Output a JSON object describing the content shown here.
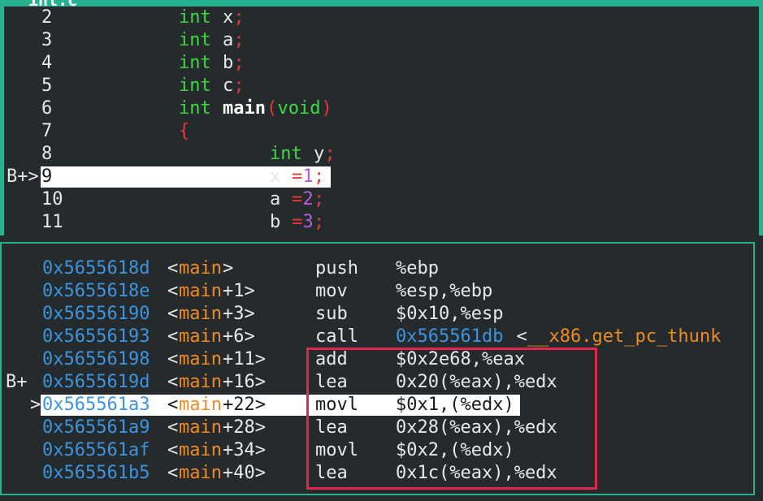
{
  "source": {
    "title": "int.c",
    "lines": [
      {
        "no": "2",
        "marker": "",
        "tokens": [
          {
            "t": "int ",
            "c": "type"
          },
          {
            "t": "x",
            "c": "ident"
          },
          {
            "t": ";",
            "c": "punct"
          }
        ],
        "indent": 1
      },
      {
        "no": "3",
        "marker": "",
        "tokens": [
          {
            "t": "int ",
            "c": "type"
          },
          {
            "t": "a",
            "c": "ident"
          },
          {
            "t": ";",
            "c": "punct"
          }
        ],
        "indent": 1
      },
      {
        "no": "4",
        "marker": "",
        "tokens": [
          {
            "t": "int ",
            "c": "type"
          },
          {
            "t": "b",
            "c": "ident"
          },
          {
            "t": ";",
            "c": "punct"
          }
        ],
        "indent": 1
      },
      {
        "no": "5",
        "marker": "",
        "tokens": [
          {
            "t": "int ",
            "c": "type"
          },
          {
            "t": "c",
            "c": "ident"
          },
          {
            "t": ";",
            "c": "punct"
          }
        ],
        "indent": 1
      },
      {
        "no": "6",
        "marker": "",
        "tokens": [
          {
            "t": "int ",
            "c": "type"
          },
          {
            "t": "main",
            "c": "fn"
          },
          {
            "t": "(",
            "c": "punct"
          },
          {
            "t": "void",
            "c": "type"
          },
          {
            "t": ")",
            "c": "punct"
          }
        ],
        "indent": 1
      },
      {
        "no": "7",
        "marker": "",
        "tokens": [
          {
            "t": "{",
            "c": "punct"
          }
        ],
        "indent": 1
      },
      {
        "no": "8",
        "marker": "",
        "tokens": [
          {
            "t": "int ",
            "c": "type"
          },
          {
            "t": "y",
            "c": "ident"
          },
          {
            "t": ";",
            "c": "punct"
          }
        ],
        "indent": 2
      },
      {
        "no": "9",
        "marker": "B+>",
        "highlight": true,
        "tokens": [
          {
            "t": "x ",
            "c": "ident"
          },
          {
            "t": "=",
            "c": "punct"
          },
          {
            "t": "1",
            "c": "num"
          },
          {
            "t": ";",
            "c": "punct"
          }
        ],
        "indent": 2
      },
      {
        "no": "10",
        "marker": "",
        "tokens": [
          {
            "t": "a ",
            "c": "ident"
          },
          {
            "t": "=",
            "c": "punct"
          },
          {
            "t": "2",
            "c": "num"
          },
          {
            "t": ";",
            "c": "punct"
          }
        ],
        "indent": 2
      },
      {
        "no": "11",
        "marker": "",
        "tokens": [
          {
            "t": "b ",
            "c": "ident"
          },
          {
            "t": "=",
            "c": "punct"
          },
          {
            "t": "3",
            "c": "num"
          },
          {
            "t": ";",
            "c": "punct"
          }
        ],
        "indent": 2
      }
    ]
  },
  "asm": {
    "lines": [
      {
        "marker": "",
        "addr": "0x5655618d",
        "sym": "main",
        "off": "",
        "op": "push",
        "args": "%ebp"
      },
      {
        "marker": "",
        "addr": "0x5655618e",
        "sym": "main",
        "off": "+1",
        "op": "mov",
        "args": "%esp,%ebp"
      },
      {
        "marker": "",
        "addr": "0x56556190",
        "sym": "main",
        "off": "+3",
        "op": "sub",
        "args": "$0x10,%esp"
      },
      {
        "marker": "",
        "addr": "0x56556193",
        "sym": "main",
        "off": "+6",
        "op": "call",
        "args": "",
        "target_addr": "0x565561db",
        "target_sym": "__x86.get_pc_thunk"
      },
      {
        "marker": "",
        "addr": "0x56556198",
        "sym": "main",
        "off": "+11",
        "op": "add",
        "args": "$0x2e68,%eax"
      },
      {
        "marker": "B+",
        "addr": "0x5655619d",
        "sym": "main",
        "off": "+16",
        "op": "lea",
        "args": "0x20(%eax),%edx"
      },
      {
        "marker": ">",
        "addr": "0x565561a3",
        "sym": "main",
        "off": "+22",
        "op": "movl",
        "args": "$0x1,(%edx)",
        "highlight": true
      },
      {
        "marker": "",
        "addr": "0x565561a9",
        "sym": "main",
        "off": "+28",
        "op": "lea",
        "args": "0x28(%eax),%edx"
      },
      {
        "marker": "",
        "addr": "0x565561af",
        "sym": "main",
        "off": "+34",
        "op": "movl",
        "args": "$0x2,(%edx)"
      },
      {
        "marker": "",
        "addr": "0x565561b5",
        "sym": "main",
        "off": "+40",
        "op": "lea",
        "args": "0x1c(%eax),%edx"
      }
    ]
  },
  "colors": {
    "border": "#27b38f",
    "annotation_box": "#e0274f",
    "type": "#3fd93f",
    "punct": "#e53935",
    "number": "#b25cd6",
    "address": "#3b94e0",
    "symbol": "#f08a1f"
  }
}
